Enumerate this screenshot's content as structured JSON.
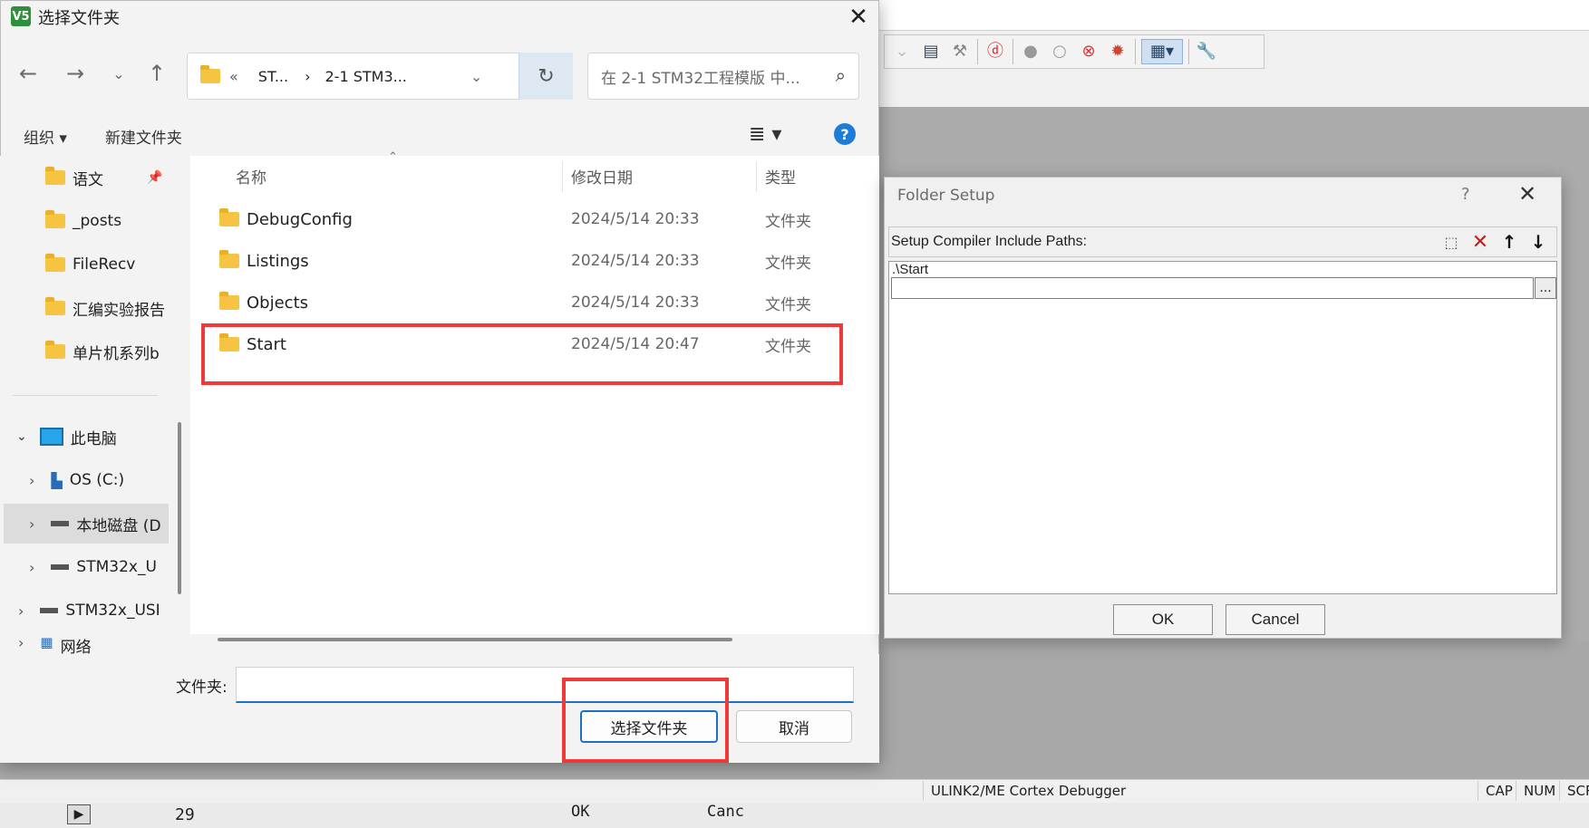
{
  "file_dialog": {
    "title": "选择文件夹",
    "app_icon_text": "V5",
    "breadcrumb": {
      "overflow": "«",
      "crumb_1": "ST...",
      "separator": "›",
      "crumb_2": "2-1 STM3..."
    },
    "search_placeholder": "在 2-1 STM32工程模版 中...",
    "commands": {
      "organize": "组织 ▾",
      "new_folder": "新建文件夹"
    },
    "nav_items": [
      {
        "label": "语文",
        "pinned": true
      },
      {
        "label": "_posts"
      },
      {
        "label": "FileRecv"
      },
      {
        "label": "汇编实验报告"
      },
      {
        "label": "单片机系列b"
      }
    ],
    "tree": {
      "this_pc": "此电脑",
      "drives": [
        {
          "label": "OS (C:)"
        },
        {
          "label": "本地磁盘 (D"
        },
        {
          "label": "STM32x_U"
        },
        {
          "label": "STM32x_USI"
        },
        {
          "label": "网络"
        }
      ]
    },
    "columns": {
      "name": "名称",
      "date": "修改日期",
      "type": "类型"
    },
    "files": [
      {
        "name": "DebugConfig",
        "date": "2024/5/14 20:33",
        "type": "文件夹"
      },
      {
        "name": "Listings",
        "date": "2024/5/14 20:33",
        "type": "文件夹"
      },
      {
        "name": "Objects",
        "date": "2024/5/14 20:33",
        "type": "文件夹"
      },
      {
        "name": "Start",
        "date": "2024/5/14 20:47",
        "type": "文件夹"
      }
    ],
    "folder_label": "文件夹:",
    "folder_value": "",
    "select_button": "选择文件夹",
    "cancel_button": "取消"
  },
  "folder_setup": {
    "title": "Folder Setup",
    "help": "?",
    "label": "Setup Compiler Include Paths:",
    "entries": [
      ".\\Start"
    ],
    "browse": "...",
    "ok": "OK",
    "cancel": "Cancel"
  },
  "ide": {
    "status_debugger": "ULINK2/ME Cortex Debugger",
    "status_cap": "CAP",
    "status_num": "NUM",
    "status_scr": "SCR",
    "bottom_line_number": "29",
    "bottom_ok": "OK",
    "bottom_cancel": "Canc"
  },
  "colors": {
    "highlight_red": "#f03a3a",
    "accent_blue": "#1e6fc8",
    "folder_yellow": "#f7c342"
  }
}
